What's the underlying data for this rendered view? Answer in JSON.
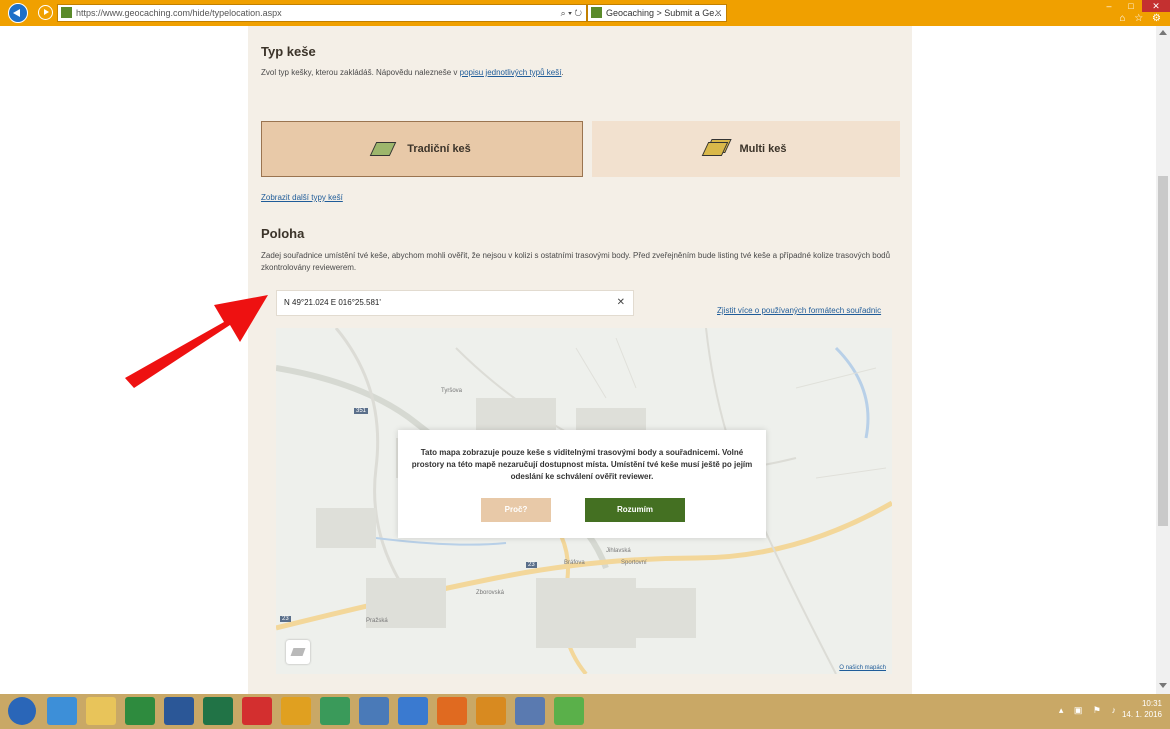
{
  "browser": {
    "url": "https://www.geocaching.com/hide/typelocation.aspx",
    "url_tools": "⌕ ▾ ↻",
    "tab_title": "Geocaching > Submit a Ge...",
    "tab_close": "✕",
    "win_min": "–",
    "win_max": "□",
    "win_close": "✕",
    "fav_icons": "⌂ ☆ ⚙"
  },
  "cache_type": {
    "heading": "Typ keše",
    "intro": "Zvol typ kešky, kterou zakládáš. Nápovědu nalezneše v ",
    "intro_link": "popisu jednotlivých typů keší",
    "intro_end": ".",
    "options": [
      {
        "label": "Tradiční keš",
        "icon": "traditional-cache-icon",
        "selected": true
      },
      {
        "label": "Multi keš",
        "icon": "multi-cache-icon",
        "selected": false
      }
    ],
    "more_link": "Zobrazit další typy keší"
  },
  "location": {
    "heading": "Poloha",
    "description": "Zadej souřadnice umístění tvé keše, abychom mohli ověřit, že nejsou v kolizi s ostatními trasovými body. Před zveřejněním bude listing tvé keše a případné kolize trasových bodů zkontrolovány reviewerem.",
    "coordinates_value": "N 49°21.024 E 016°25.581'",
    "clear_label": "✕",
    "formats_link": "Zjistit více o používaných formátech souřadnic"
  },
  "map": {
    "road_labels": [
      "351",
      "23",
      "23"
    ],
    "place_labels": [
      "Bráfova",
      "Jihlavská",
      "Tyršova",
      "Sportovní",
      "Pražská",
      "Zborovská"
    ],
    "attribution_link": "O našich mapách",
    "dialog": {
      "message": "Tato mapa zobrazuje pouze keše s viditelnými trasovými body a souřadnicemi. Volné prostory na této mapě nezaručují dostupnost místa. Umístění tvé keše musí ještě po jejím odeslání ke schválení ověřit reviewer.",
      "why_button": "Proč?",
      "ok_button": "Rozumím"
    }
  },
  "taskbar": {
    "time": "10:31",
    "date": "14. 1. 2016",
    "tray_icons": "▴ ▣ ⚑ ♪",
    "apps": [
      {
        "name": "start",
        "color": "#2a66b8"
      },
      {
        "name": "internet-explorer",
        "color": "#3d8fd8"
      },
      {
        "name": "file-explorer",
        "color": "#e8c45a"
      },
      {
        "name": "store",
        "color": "#2e8b3e"
      },
      {
        "name": "word",
        "color": "#2b5797"
      },
      {
        "name": "excel",
        "color": "#217346"
      },
      {
        "name": "acrobat",
        "color": "#d32f2f"
      },
      {
        "name": "chrome",
        "color": "#e0a020"
      },
      {
        "name": "calculator",
        "color": "#3a9a5a"
      },
      {
        "name": "photos",
        "color": "#4a7ab8"
      },
      {
        "name": "picture-viewer",
        "color": "#3a7ad0"
      },
      {
        "name": "firefox",
        "color": "#e06a20"
      },
      {
        "name": "paint",
        "color": "#d88a20"
      },
      {
        "name": "display",
        "color": "#5a7ab0"
      },
      {
        "name": "chrome-2",
        "color": "#5ab04a"
      }
    ]
  }
}
